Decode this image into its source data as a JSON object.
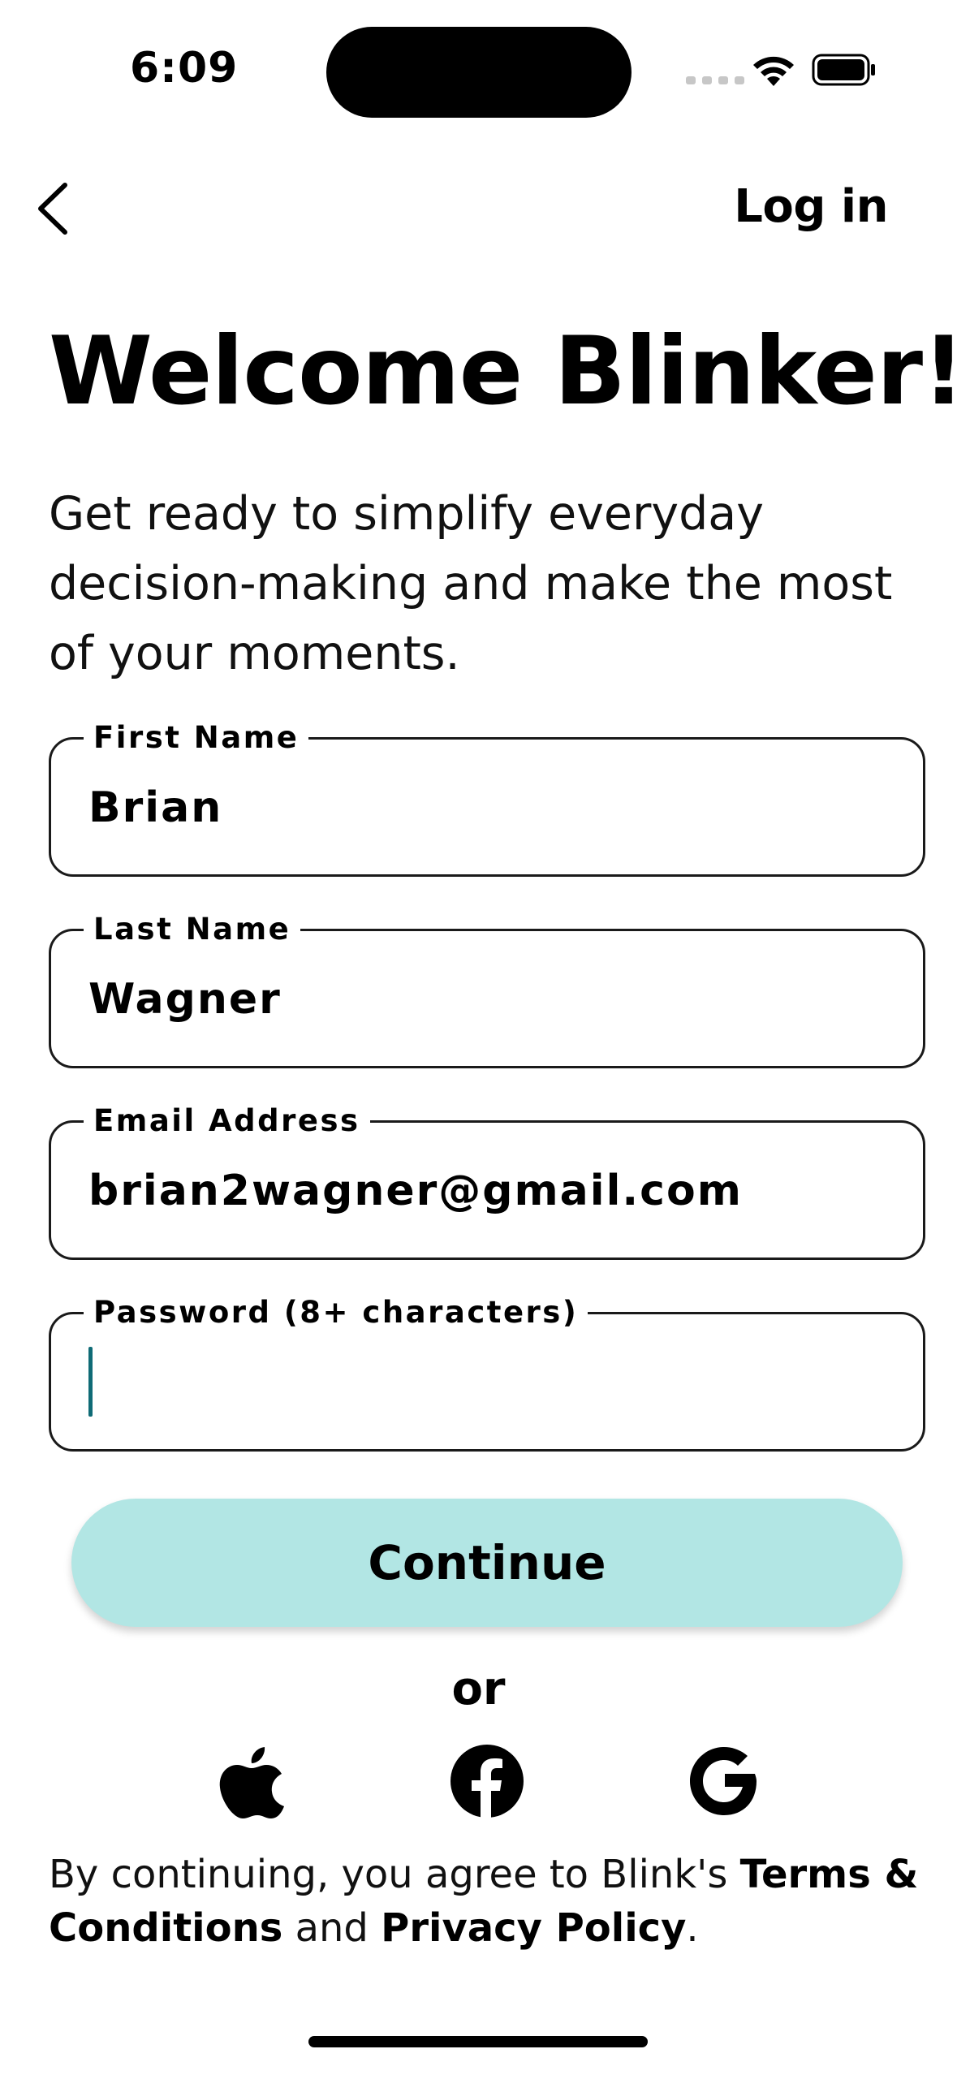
{
  "status_bar": {
    "time": "6:09"
  },
  "header": {
    "login_label": "Log in"
  },
  "welcome": {
    "title": "Welcome Blinker!",
    "subtitle": "Get ready to simplify everyday decision-making and make the most of your moments."
  },
  "form": {
    "first_name": {
      "label": "First Name",
      "value": "Brian"
    },
    "last_name": {
      "label": "Last Name",
      "value": "Wagner"
    },
    "email": {
      "label": "Email Address",
      "value": "brian2wagner@gmail.com"
    },
    "password": {
      "label": "Password (8+ characters)",
      "value": ""
    }
  },
  "continue_label": "Continue",
  "or_label": "or",
  "social": [
    "apple-icon",
    "facebook-icon",
    "google-icon"
  ],
  "legal": {
    "prefix": "By continuing, you agree to Blink's ",
    "terms": "Terms & Conditions",
    "middle": " and ",
    "privacy": "Privacy Policy",
    "suffix": "."
  },
  "colors": {
    "accent": "#b2e6e4",
    "caret": "#0f6b76",
    "text": "#000000",
    "border": "#1a1a1a"
  }
}
